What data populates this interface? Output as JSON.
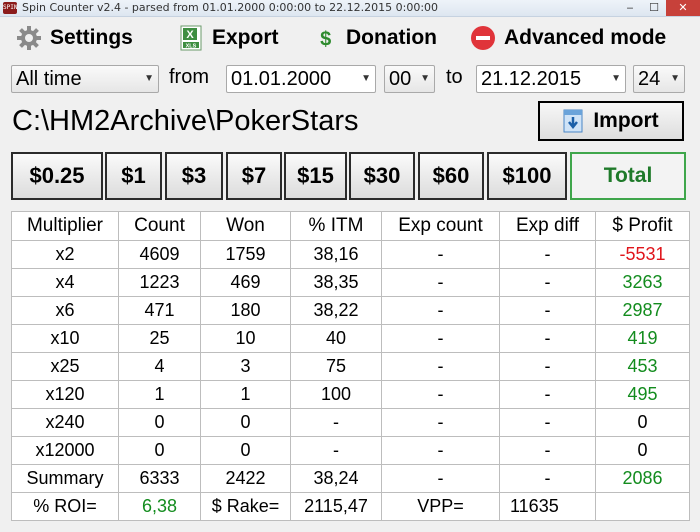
{
  "window": {
    "title": "Spin Counter v2.4 - parsed from 01.01.2000 0:00:00 to 22.12.2015 0:00:00",
    "app_icon_text": "SPIN",
    "minimize": "‒",
    "maximize": "☐",
    "close": "✕"
  },
  "menu": {
    "settings": "Settings",
    "export": "Export",
    "donation": "Donation",
    "advanced": "Advanced mode"
  },
  "filters": {
    "range": "All time",
    "from_label": "from",
    "from_date": "01.01.2000",
    "from_hour": "00",
    "to_label": "to",
    "to_date": "21.12.2015",
    "to_hour": "24"
  },
  "path": "C:\\HM2Archive\\PokerStars",
  "import_label": "Import",
  "stakes": [
    "$0.25",
    "$1",
    "$3",
    "$7",
    "$15",
    "$30",
    "$60",
    "$100"
  ],
  "total_label": "Total",
  "table": {
    "headers": [
      "Multiplier",
      "Count",
      "Won",
      "% ITM",
      "Exp count",
      "Exp diff",
      "$ Profit"
    ],
    "rows": [
      [
        "x2",
        "4609",
        "1759",
        "38,16",
        "-",
        "-",
        "-5531"
      ],
      [
        "x4",
        "1223",
        "469",
        "38,35",
        "-",
        "-",
        "3263"
      ],
      [
        "x6",
        "471",
        "180",
        "38,22",
        "-",
        "-",
        "2987"
      ],
      [
        "x10",
        "25",
        "10",
        "40",
        "-",
        "-",
        "419"
      ],
      [
        "x25",
        "4",
        "3",
        "75",
        "-",
        "-",
        "453"
      ],
      [
        "x120",
        "1",
        "1",
        "100",
        "-",
        "-",
        "495"
      ],
      [
        "x240",
        "0",
        "0",
        "-",
        "-",
        "-",
        "0"
      ],
      [
        "x12000",
        "0",
        "0",
        "-",
        "-",
        "-",
        "0"
      ],
      [
        "Summary",
        "6333",
        "2422",
        "38,24",
        "-",
        "-",
        "2086"
      ]
    ],
    "footer": {
      "roi_label": "% ROI=",
      "roi_value": "6,38",
      "rake_label": "$ Rake=",
      "rake_value": "2115,47",
      "vpp_label": "VPP=",
      "vpp_value": "11635"
    }
  },
  "colors": {
    "negative": "#e0151b",
    "positive": "#138c1e",
    "total_border": "#3fa64b"
  }
}
